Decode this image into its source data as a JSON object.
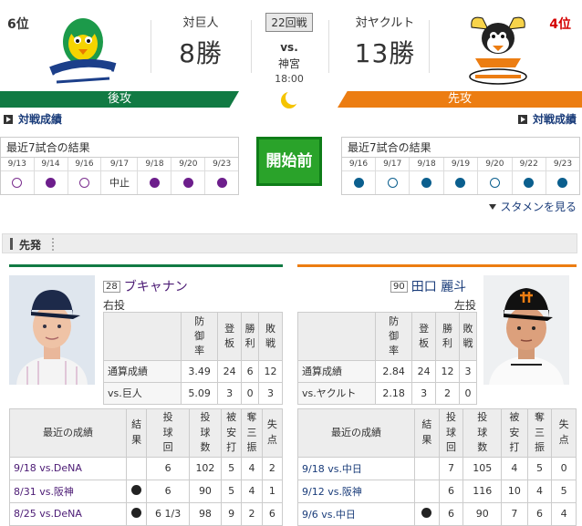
{
  "header": {
    "home_rank": "6位",
    "away_rank": "4位",
    "home_vs_label": "対巨人",
    "home_wins": "8勝",
    "away_vs_label": "対ヤクルト",
    "away_wins": "13勝",
    "game_no": "22回戦",
    "vs": "vs.",
    "stadium": "神宮",
    "time": "18:00",
    "home_side": "後攻",
    "away_side": "先攻",
    "home_link": "対戦成績",
    "away_link": "対戦成績",
    "colors": {
      "swallows_green": "#117a43",
      "giants_orange": "#ec7d12",
      "start_green": "#2aa32a"
    }
  },
  "recent": {
    "home": {
      "title": "最近7試合の結果",
      "dates": [
        "9/13",
        "9/14",
        "9/16",
        "9/17",
        "9/18",
        "9/20",
        "9/23"
      ],
      "results": [
        "open",
        "purple",
        "open",
        "中止",
        "purple",
        "purple",
        "purple"
      ]
    },
    "away": {
      "title": "最近7試合の結果",
      "dates": [
        "9/16",
        "9/17",
        "9/18",
        "9/19",
        "9/20",
        "9/22",
        "9/23"
      ],
      "results": [
        "blue",
        "open",
        "blue",
        "blue",
        "open",
        "blue",
        "blue"
      ]
    },
    "start_button": "開始前",
    "starter_link": "スタメンを見る"
  },
  "section_title": "先発",
  "home_pitcher": {
    "number": "28",
    "name": "ブキャナン",
    "hand": "右投",
    "stat_headers": [
      "防御率",
      "登板",
      "勝利",
      "敗戦"
    ],
    "rows": [
      {
        "label": "通算成績",
        "values": [
          "3.49",
          "24",
          "6",
          "12"
        ]
      },
      {
        "label": "vs.巨人",
        "values": [
          "5.09",
          "3",
          "0",
          "3"
        ]
      }
    ],
    "recent_title": "最近の成績",
    "recent_headers": [
      "結果",
      "投球回",
      "投球数",
      "被安打",
      "奪三振",
      "失点"
    ],
    "recent_rows": [
      {
        "game": "9/18 vs.DeNA",
        "result": "",
        "ip": "6",
        "pitches": "102",
        "hits": "5",
        "so": "4",
        "runs": "2"
      },
      {
        "game": "8/31 vs.阪神",
        "result": "●",
        "ip": "6",
        "pitches": "90",
        "hits": "5",
        "so": "4",
        "runs": "1"
      },
      {
        "game": "8/25 vs.DeNA",
        "result": "●",
        "ip": "6 1/3",
        "pitches": "98",
        "hits": "9",
        "so": "2",
        "runs": "6"
      }
    ]
  },
  "away_pitcher": {
    "number": "90",
    "name": "田口 麗斗",
    "hand": "左投",
    "stat_headers": [
      "防御率",
      "登板",
      "勝利",
      "敗戦"
    ],
    "rows": [
      {
        "label": "通算成績",
        "values": [
          "2.84",
          "24",
          "12",
          "3"
        ]
      },
      {
        "label": "vs.ヤクルト",
        "values": [
          "2.18",
          "3",
          "2",
          "0"
        ]
      }
    ],
    "recent_title": "最近の成績",
    "recent_headers": [
      "結果",
      "投球回",
      "投球数",
      "被安打",
      "奪三振",
      "失点"
    ],
    "recent_rows": [
      {
        "game": "9/18 vs.中日",
        "result": "",
        "ip": "7",
        "pitches": "105",
        "hits": "4",
        "so": "5",
        "runs": "0"
      },
      {
        "game": "9/12 vs.阪神",
        "result": "",
        "ip": "6",
        "pitches": "116",
        "hits": "10",
        "so": "4",
        "runs": "5"
      },
      {
        "game": "9/6 vs.中日",
        "result": "●",
        "ip": "6",
        "pitches": "90",
        "hits": "7",
        "so": "6",
        "runs": "4"
      }
    ]
  }
}
